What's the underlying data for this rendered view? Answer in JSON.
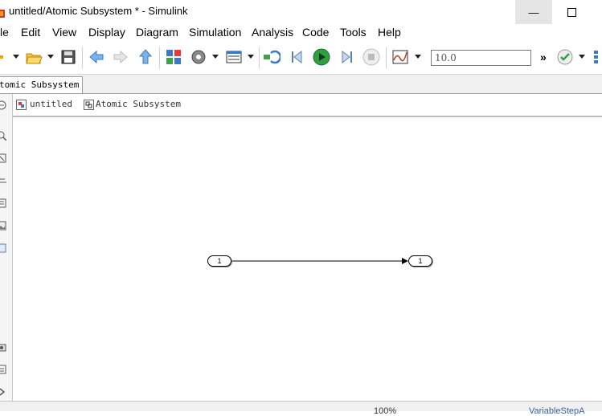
{
  "window": {
    "title": "untitled/Atomic Subsystem * - Simulink",
    "minimize_glyph": "—",
    "maximize_glyph": "☐"
  },
  "menu": [
    "le",
    "Edit",
    "View",
    "Display",
    "Diagram",
    "Simulation",
    "Analysis",
    "Code",
    "Tools",
    "Help"
  ],
  "toolbar": {
    "stop_time": "10.0",
    "more_glyph": "»",
    "icons": [
      "new-model-icon",
      "open-icon",
      "save-icon",
      "back-icon",
      "forward-icon",
      "up-icon",
      "library-browser-icon",
      "settings-icon",
      "model-explorer-icon",
      "update-diagram-icon",
      "step-back-icon",
      "run-icon",
      "step-forward-icon",
      "stop-icon",
      "scope-icon",
      "check-icon",
      "grid-icon"
    ]
  },
  "tab": {
    "label": "tomic Subsystem"
  },
  "breadcrumb": {
    "root": "untitled",
    "child": "Atomic Subsystem"
  },
  "canvas": {
    "inport": "1",
    "outport": "1"
  },
  "status": {
    "zoom": "100%",
    "solver": "VariableStepA"
  },
  "colors": {
    "run_green": "#2ea043",
    "arrow_blue": "#3a78c8"
  }
}
